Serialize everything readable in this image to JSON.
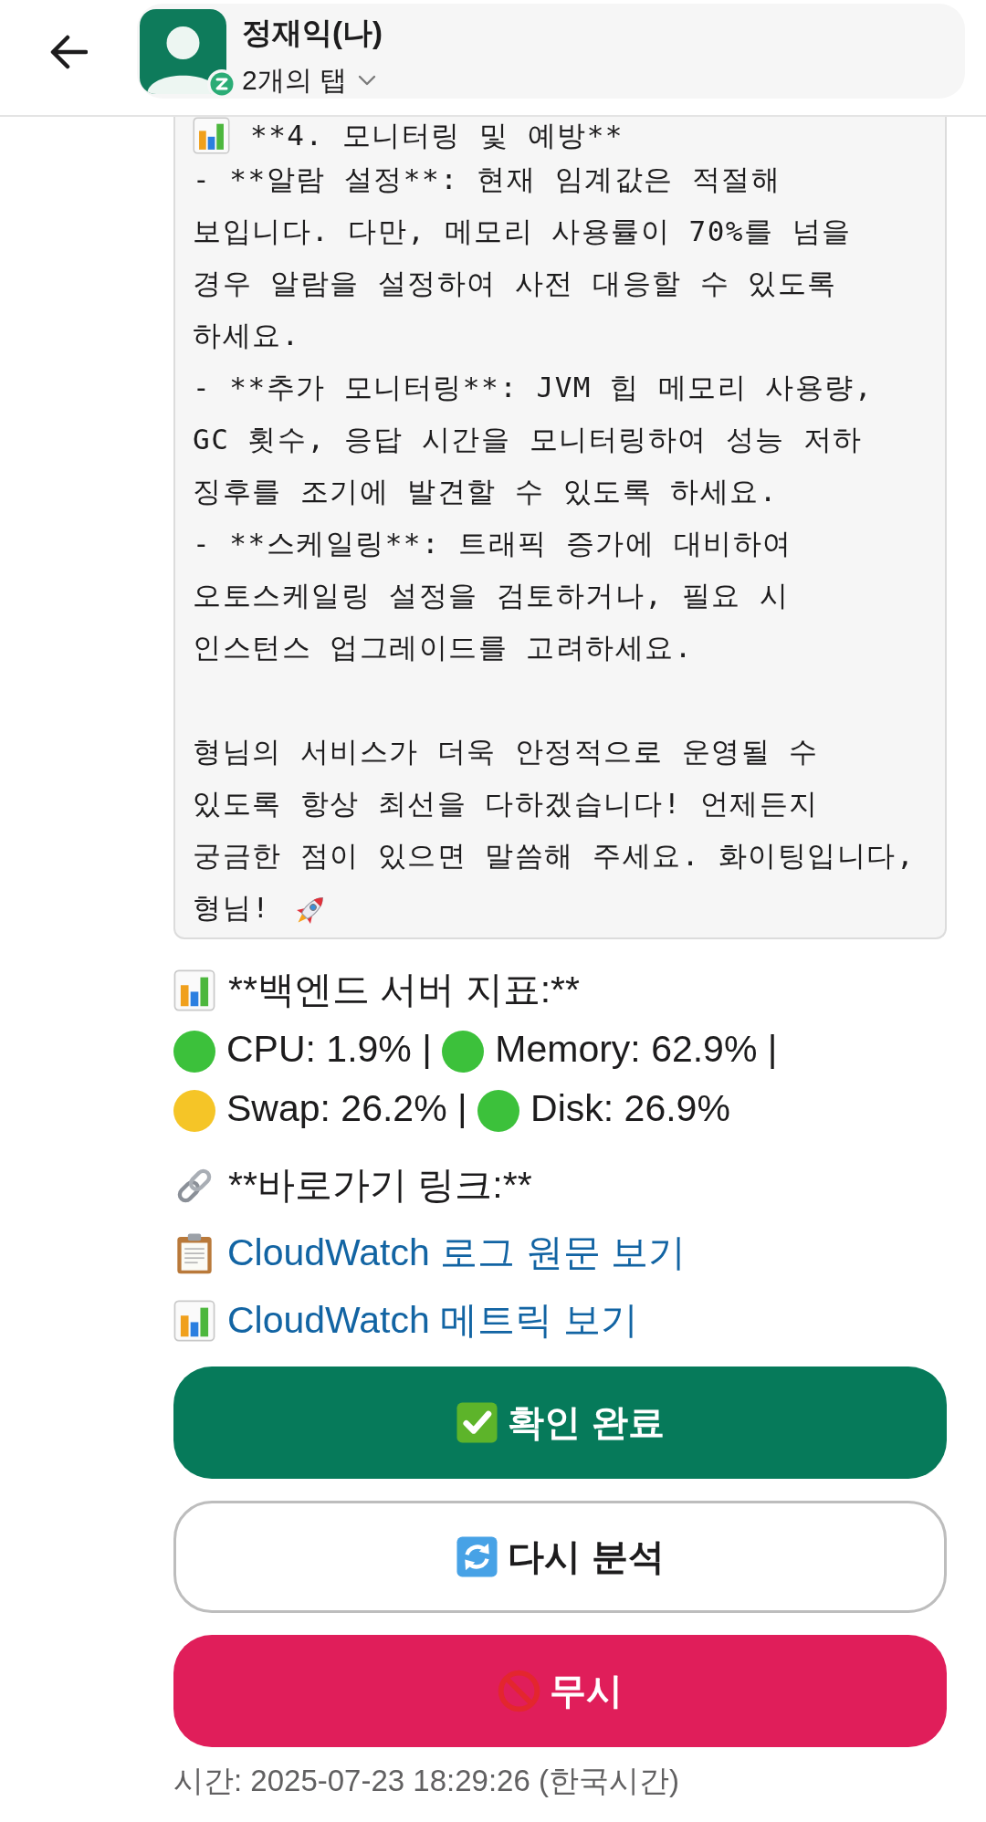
{
  "header": {
    "name": "정재익(나)",
    "tabs_label": "2개의 탭",
    "dnd": true
  },
  "code_block": {
    "heading": "**4. 모니터링 및 예방**",
    "bullets": [
      {
        "lines": [
          "- **알람 설정**: 현재 임계값은 적절해",
          "보입니다. 다만, 메모리 사용률이 70%를 넘을",
          "경우 알람을 설정하여 사전 대응할 수 있도록",
          "하세요."
        ]
      },
      {
        "lines": [
          "- **추가 모니터링**: JVM 힙 메모리 사용량,",
          "GC 횟수, 응답 시간을 모니터링하여 성능 저하",
          "징후를 조기에 발견할 수 있도록 하세요."
        ]
      },
      {
        "lines": [
          "- **스케일링**: 트래픽 증가에 대비하여",
          "오토스케일링 설정을 검토하거나, 필요 시",
          "인스턴스 업그레이드를 고려하세요."
        ]
      }
    ],
    "closing": {
      "lines": [
        "형님의 서비스가 더욱 안정적으로 운영될 수",
        "있도록 항상 최선을 다하겠습니다! 언제든지",
        "궁금한 점이 있으면 말씀해 주세요. 화이팅입니다,",
        "형님!"
      ]
    }
  },
  "metrics": {
    "heading": "**백엔드 서버 지표:**",
    "items": [
      {
        "label": "CPU: 1.9%",
        "color": "#3cc13b",
        "separator": "|"
      },
      {
        "label": "Memory: 62.9%",
        "color": "#3cc13b",
        "separator": "|"
      },
      {
        "label": "Swap: 26.2%",
        "color": "#f5c527",
        "separator": "|"
      },
      {
        "label": "Disk: 26.9%",
        "color": "#3cc13b"
      }
    ]
  },
  "links": {
    "heading": "**바로가기 링크:**",
    "items": [
      {
        "label": "CloudWatch 로그 원문 보기",
        "kind": "log"
      },
      {
        "label": "CloudWatch 메트릭 보기",
        "kind": "metric"
      }
    ]
  },
  "buttons": [
    {
      "label": "확인 완료",
      "kind": "primary"
    },
    {
      "label": "다시 분석",
      "kind": "secondary"
    },
    {
      "label": "무시",
      "kind": "danger"
    }
  ],
  "timestamp": "시간: 2025-07-23 18:29:26 (한국시간)"
}
